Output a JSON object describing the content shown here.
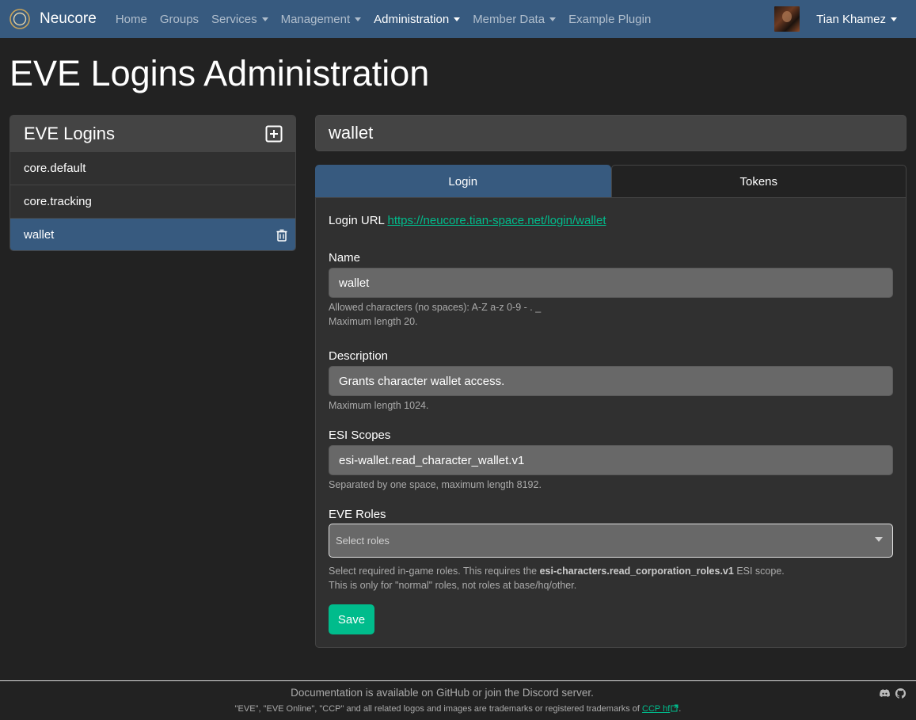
{
  "navbar": {
    "brand": "Neucore",
    "items": [
      {
        "label": "Home",
        "dropdown": false,
        "active": false
      },
      {
        "label": "Groups",
        "dropdown": false,
        "active": false
      },
      {
        "label": "Services",
        "dropdown": true,
        "active": false
      },
      {
        "label": "Management",
        "dropdown": true,
        "active": false
      },
      {
        "label": "Administration",
        "dropdown": true,
        "active": true
      },
      {
        "label": "Member Data",
        "dropdown": true,
        "active": false
      },
      {
        "label": "Example Plugin",
        "dropdown": false,
        "active": false
      }
    ],
    "user_name": "Tian Khamez"
  },
  "page_title": "EVE Logins Administration",
  "sidebar": {
    "title": "EVE Logins",
    "items": [
      {
        "label": "core.default",
        "active": false
      },
      {
        "label": "core.tracking",
        "active": false
      },
      {
        "label": "wallet",
        "active": true
      }
    ]
  },
  "detail": {
    "title": "wallet",
    "tabs": [
      {
        "label": "Login",
        "active": true
      },
      {
        "label": "Tokens",
        "active": false
      }
    ],
    "login_url_label": "Login URL",
    "login_url": "https://neucore.tian-space.net/login/wallet",
    "name": {
      "label": "Name",
      "value": "wallet",
      "help_1": "Allowed characters (no spaces): A-Z a-z 0-9 - . _",
      "help_2": "Maximum length 20."
    },
    "description": {
      "label": "Description",
      "value": "Grants character wallet access.",
      "help": "Maximum length 1024."
    },
    "esi_scopes": {
      "label": "ESI Scopes",
      "value": "esi-wallet.read_character_wallet.v1",
      "help": "Separated by one space, maximum length 8192."
    },
    "eve_roles": {
      "label": "EVE Roles",
      "placeholder": "Select roles",
      "help_1_pre": "Select required in-game roles. This requires the ",
      "help_1_bold": "esi-characters.read_corporation_roles.v1",
      "help_1_post": " ESI scope.",
      "help_2": "This is only for \"normal\" roles, not roles at base/hq/other."
    },
    "save_label": "Save"
  },
  "footer": {
    "line1": "Documentation is available on GitHub or join the Discord server.",
    "line2_text": "\"EVE\", \"EVE Online\", \"CCP\" and all related logos and images are trademarks or registered trademarks of ",
    "line2_link": "CCP hf",
    "line2_end": "."
  },
  "colors": {
    "navbar": "#375a7f",
    "background": "#222222",
    "accent": "#00bc8c",
    "card": "#303030",
    "input": "#686868"
  },
  "icons": {
    "brand": "neucore-logo-icon",
    "add": "plus-square-icon",
    "delete": "trash-icon",
    "external": "external-link-icon",
    "discord": "discord-icon",
    "github": "github-icon"
  }
}
